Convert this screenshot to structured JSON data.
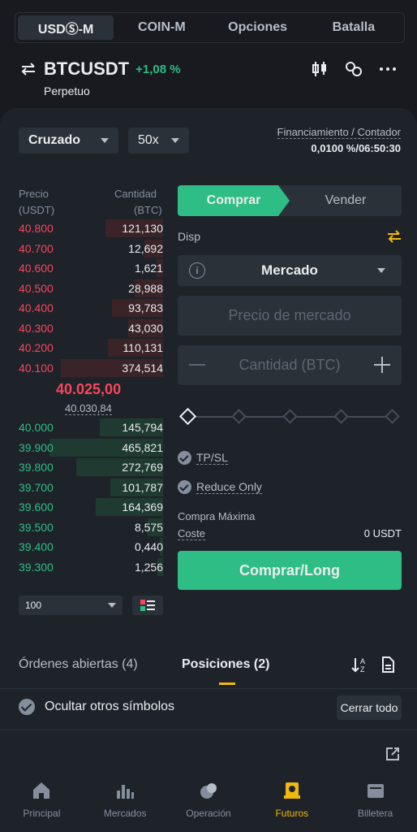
{
  "market_tabs": [
    "USDⓈ-M",
    "COIN-M",
    "Opciones",
    "Batalla"
  ],
  "symbol": {
    "name": "BTCUSDT",
    "change": "+1,08 %",
    "type": "Perpetuo"
  },
  "controls": {
    "margin_mode": "Cruzado",
    "leverage": "50x",
    "funding_label": "Financiamiento / Contador",
    "funding_value": "0,0100 %/06:50:30"
  },
  "orderbook": {
    "price_header": "Precio",
    "price_unit": "(USDT)",
    "qty_header": "Cantidad",
    "qty_unit": "(BTC)",
    "asks": [
      {
        "price": "40.800",
        "qty": "121,130"
      },
      {
        "price": "40.700",
        "qty": "12,692"
      },
      {
        "price": "40.600",
        "qty": "1,621"
      },
      {
        "price": "40.500",
        "qty": "28,988"
      },
      {
        "price": "40.400",
        "qty": "93,783"
      },
      {
        "price": "40.300",
        "qty": "43,030"
      },
      {
        "price": "40.200",
        "qty": "110,131"
      },
      {
        "price": "40.100",
        "qty": "374,514"
      }
    ],
    "last_price": "40.025,00",
    "mark_price": "40.030,84",
    "bids": [
      {
        "price": "40.000",
        "qty": "145,794"
      },
      {
        "price": "39.900",
        "qty": "465,821"
      },
      {
        "price": "39.800",
        "qty": "272,769"
      },
      {
        "price": "39.700",
        "qty": "101,787"
      },
      {
        "price": "39.600",
        "qty": "164,369"
      },
      {
        "price": "39.500",
        "qty": "8,575"
      },
      {
        "price": "39.400",
        "qty": "0,440"
      },
      {
        "price": "39.300",
        "qty": "1,256"
      }
    ],
    "depth": "100"
  },
  "form": {
    "buy_tab": "Comprar",
    "sell_tab": "Vender",
    "available_label": "Disp",
    "order_type": "Mercado",
    "price_placeholder": "Precio de mercado",
    "qty_placeholder": "Cantidad (BTC)",
    "tpsl": "TP/SL",
    "reduce_only": "Reduce Only",
    "max_buy_label": "Compra Máxima",
    "cost_label": "Coste",
    "cost_value": "0 USDT",
    "submit": "Comprar/Long"
  },
  "orders": {
    "tab_open": "Órdenes abiertas (4)",
    "tab_positions": "Posiciones  (2)",
    "hide_others": "Ocultar otros símbolos",
    "close_all": "Cerrar todo"
  },
  "nav": [
    {
      "label": "Principal",
      "icon": "home-icon"
    },
    {
      "label": "Mercados",
      "icon": "markets-icon"
    },
    {
      "label": "Operación",
      "icon": "trade-icon"
    },
    {
      "label": "Futuros",
      "icon": "futures-icon"
    },
    {
      "label": "Billetera",
      "icon": "wallet-icon"
    }
  ],
  "colors": {
    "up": "#2ebd85",
    "down": "#f6465d",
    "accent": "#f0b90b"
  }
}
